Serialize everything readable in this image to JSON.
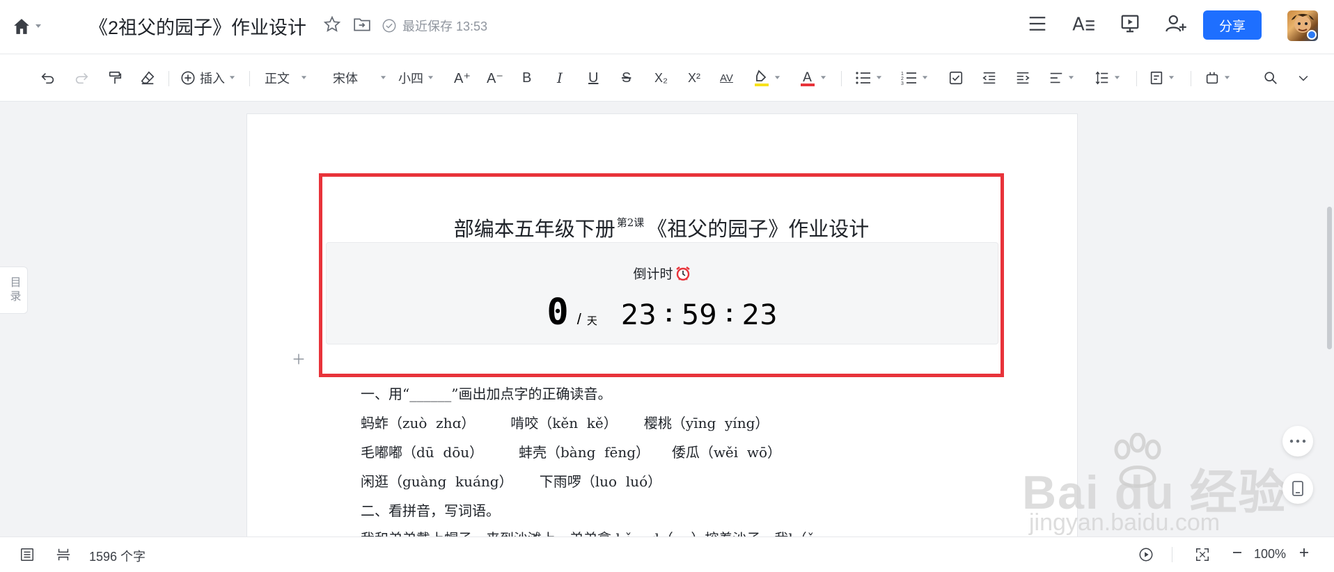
{
  "header": {
    "doc_title": "《2祖父的园子》作业设计",
    "save_status": "最近保存 13:53",
    "share_label": "分享"
  },
  "toolbar": {
    "insert_label": "插入",
    "style_label": "正文",
    "font_label": "宋体",
    "size_label": "小四",
    "bold": "B",
    "italic": "I",
    "underline": "U",
    "strike": "S",
    "subscript": "X₂",
    "superscript": "X²",
    "letter_spacing": "AV",
    "font_increase": "A⁺",
    "font_decrease": "A⁻",
    "highlight_color": "#f7e11c",
    "font_color": "#e8333a"
  },
  "sidebar": {
    "toc_label": "目录"
  },
  "document": {
    "heading_main": "部编本五年级下册",
    "heading_sup": "第2课",
    "heading_tail": "《祖父的园子》作业设计",
    "countdown": {
      "label": "倒计时",
      "days": "0",
      "slash": "/",
      "days_unit": "天",
      "hours": "23",
      "minutes": "59",
      "seconds": "23"
    },
    "lines": [
      "一、用“______”画出加点字的正确读音。",
      "蚂蚱（zuò  zhɑ）        啃咬（kěn  kě）      樱桃（yīng  yíng）",
      "毛嘟嘟（dū  dōu）        蚌壳（bàng  fēng）     倭瓜（wěi  wō）",
      "闲逛（guàng  kuáng）      下雨啰（luo  luó）",
      "二、看拼音，写词语。",
      "我和弟弟戴上帽子，来到沙滩上，弟弟拿 kǒu  d（    ）挖着沙子，我l（ǎ"
    ]
  },
  "statusbar": {
    "word_count": "1596 个字",
    "zoom": "100%"
  },
  "watermark": {
    "main": "Bai  du 经验",
    "sub": "jingyan.baidu.com"
  },
  "colors": {
    "accent": "#1e6fff",
    "highlight_border": "#e8333a"
  }
}
